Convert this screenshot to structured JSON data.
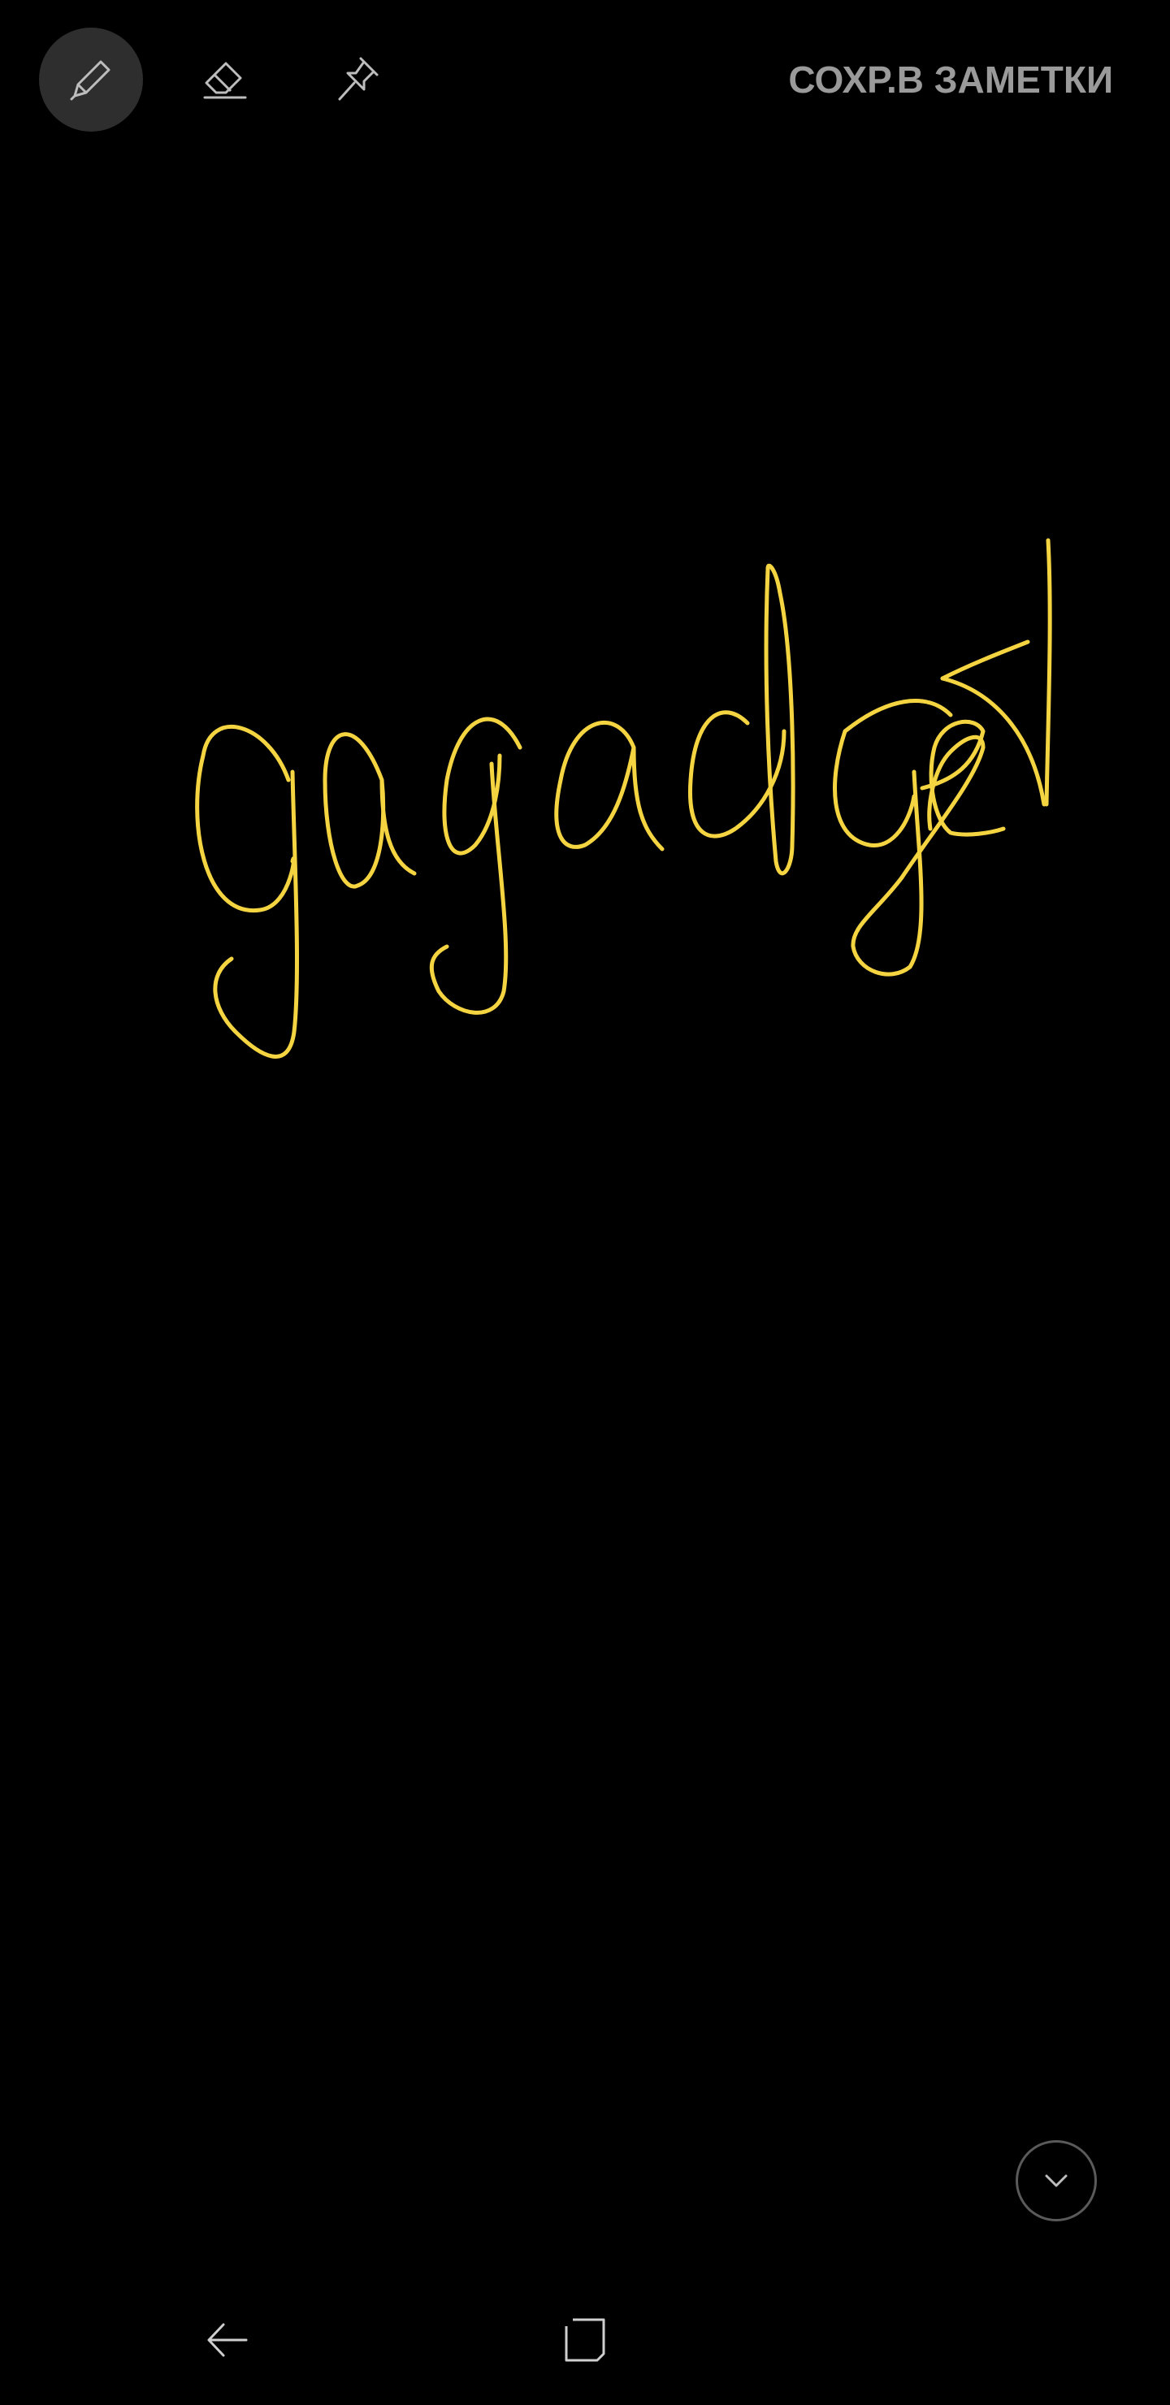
{
  "toolbar": {
    "tools": [
      {
        "icon": "pen-icon",
        "active": true
      },
      {
        "icon": "eraser-icon",
        "active": false
      },
      {
        "icon": "pin-icon",
        "active": false
      }
    ],
    "save_label": "СОХР.В ЗАМЕТКИ"
  },
  "canvas": {
    "ink_color": "#f5d442",
    "background": "#000000"
  },
  "collapse_button": {
    "icon": "chevron-down-icon"
  },
  "navbar": {
    "back_icon": "back-arrow-icon",
    "recents_icon": "recent-apps-icon"
  }
}
